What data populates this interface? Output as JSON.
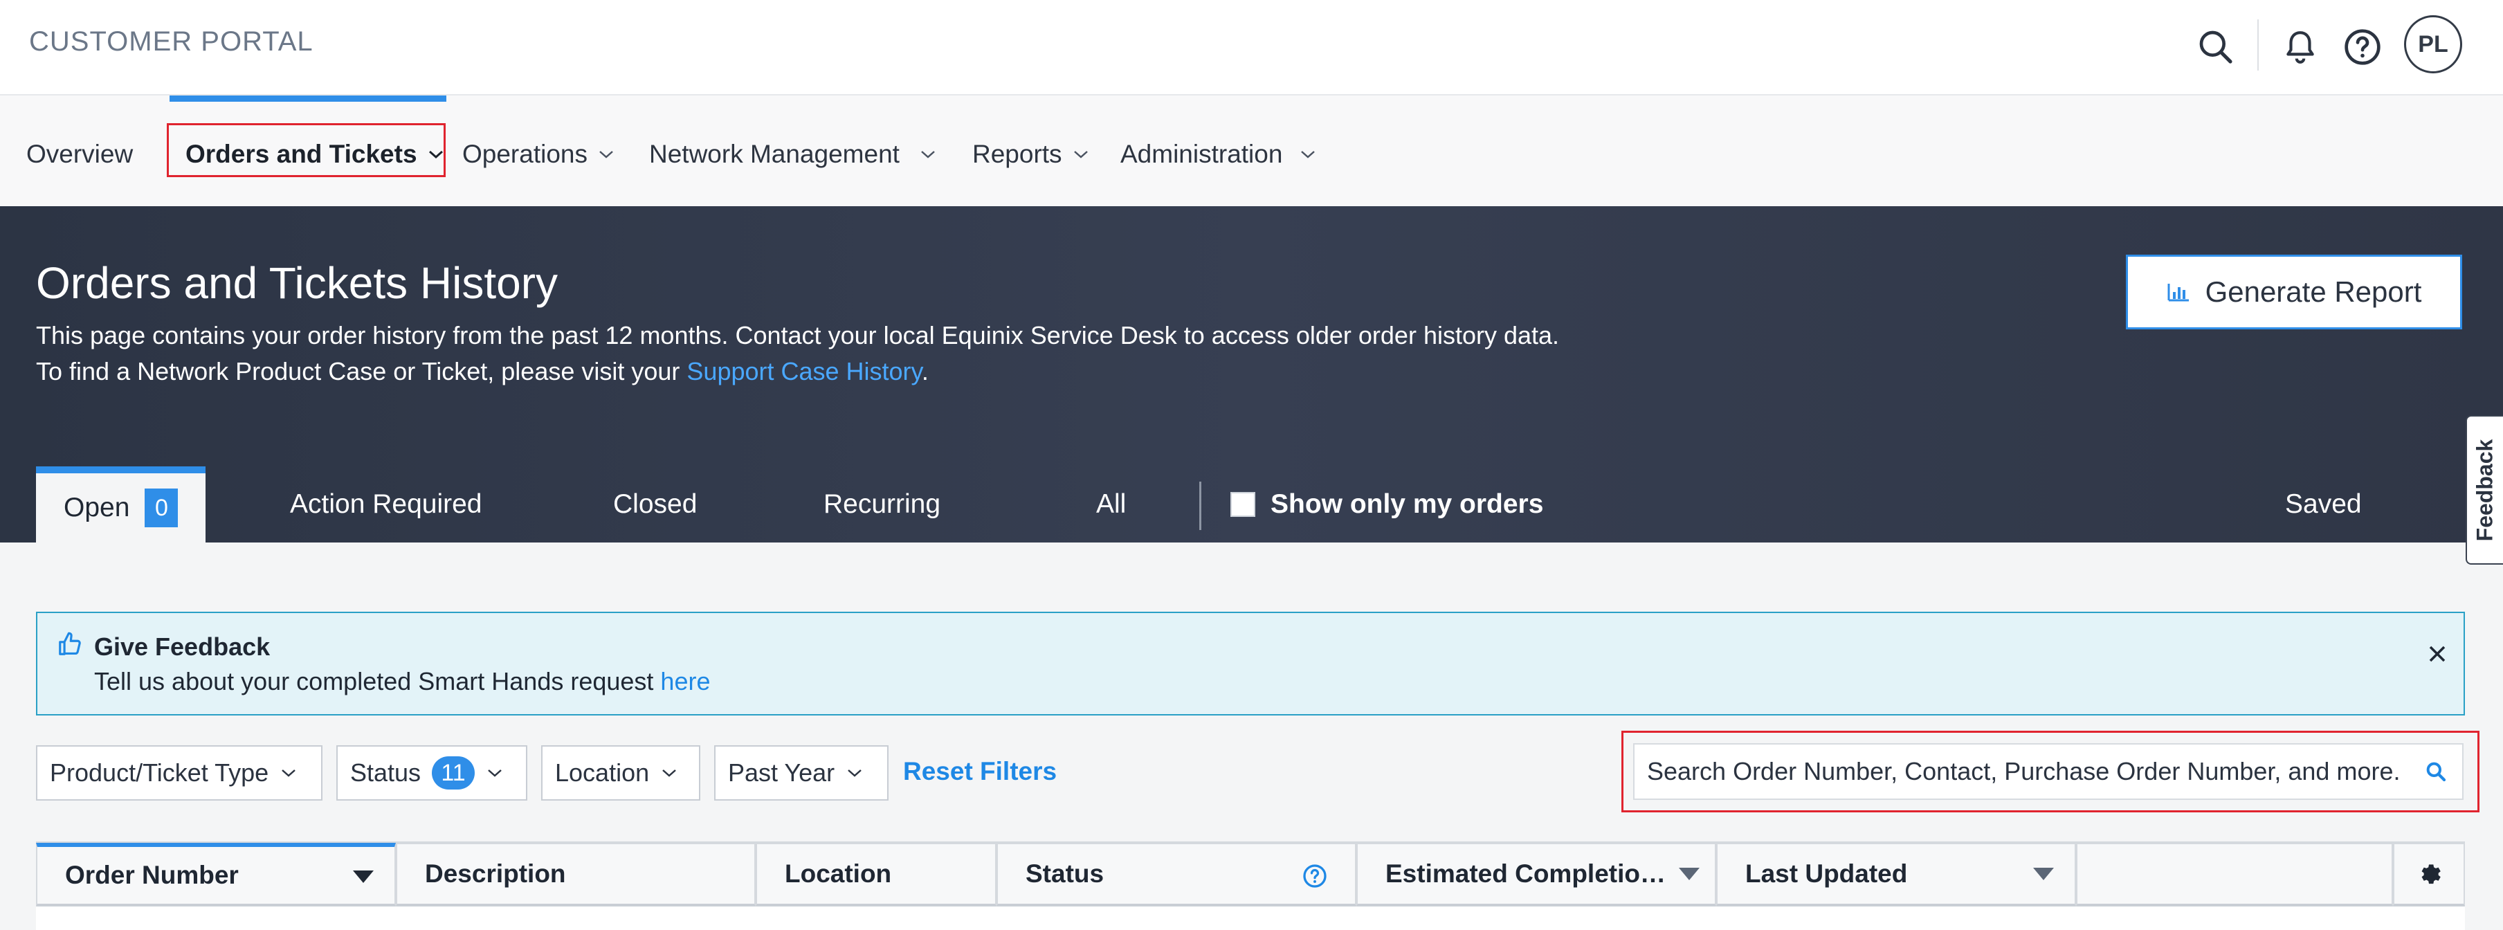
{
  "header": {
    "brand": "CUSTOMER PORTAL",
    "avatar_initials": "PL",
    "icons": [
      "search-icon",
      "bell-icon",
      "help-icon"
    ]
  },
  "nav": {
    "items": [
      {
        "label": "Overview",
        "has_dropdown": false
      },
      {
        "label": "Orders and Tickets",
        "has_dropdown": true,
        "active": true
      },
      {
        "label": "Operations",
        "has_dropdown": true
      },
      {
        "label": "Network Management",
        "has_dropdown": true
      },
      {
        "label": "Reports",
        "has_dropdown": true
      },
      {
        "label": "Administration",
        "has_dropdown": true
      }
    ]
  },
  "hero": {
    "title": "Orders and Tickets History",
    "line1": "This page contains your order history from the past 12 months. Contact your local Equinix Service Desk to access older order history data.",
    "line2_prefix": "To find a Network Product Case or Ticket, please visit your ",
    "line2_link": "Support Case History",
    "line2_suffix": ".",
    "generate_report_label": "Generate Report"
  },
  "tabs": {
    "items": [
      {
        "label": "Open",
        "badge": "0",
        "active": true
      },
      {
        "label": "Action Required"
      },
      {
        "label": "Closed"
      },
      {
        "label": "Recurring"
      },
      {
        "label": "All"
      }
    ],
    "show_mine_label": "Show only my orders",
    "saved_label": "Saved"
  },
  "side_feedback_label": "Feedback",
  "banner": {
    "title": "Give Feedback",
    "text_prefix": "Tell us about your completed Smart Hands request ",
    "link": "here"
  },
  "filters": {
    "product_type": "Product/Ticket Type",
    "status": "Status",
    "status_count": "11",
    "location": "Location",
    "period": "Past Year",
    "reset_label": "Reset Filters"
  },
  "search": {
    "placeholder": "Search Order Number, Contact, Purchase Order Number, and more."
  },
  "table": {
    "columns": [
      "Order Number",
      "Description",
      "Location",
      "Status",
      "Estimated Completio…",
      "Last Updated"
    ]
  },
  "colors": {
    "accent": "#2f8ee8",
    "highlight": "#e0242f",
    "hero_bg": "#333b4d"
  }
}
